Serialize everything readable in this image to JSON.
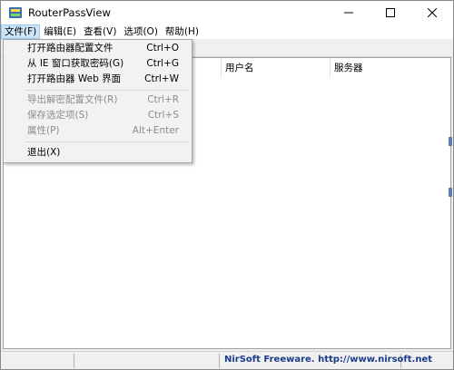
{
  "window": {
    "title": "RouterPassView"
  },
  "menubar": {
    "items": [
      "文件(F)",
      "编辑(E)",
      "查看(V)",
      "选项(O)",
      "帮助(H)"
    ]
  },
  "file_menu": {
    "items": [
      {
        "label": "打开路由器配置文件",
        "shortcut": "Ctrl+O"
      },
      {
        "label": "从 IE 窗口获取密码(G)",
        "shortcut": "Ctrl+G"
      },
      {
        "label": "打开路由器 Web 界面",
        "shortcut": "Ctrl+W"
      },
      {
        "label": "导出解密配置文件(R)",
        "shortcut": "Ctrl+R"
      },
      {
        "label": "保存选定项(S)",
        "shortcut": "Ctrl+S"
      },
      {
        "label": "属性(P)",
        "shortcut": "Alt+Enter"
      },
      {
        "label": "退出(X)",
        "shortcut": ""
      }
    ]
  },
  "listview": {
    "columns": [
      "",
      "用户名",
      "服务器"
    ]
  },
  "statusbar": {
    "text": "NirSoft Freeware.  http://www.nirsoft.net"
  },
  "colors": {
    "menu_highlight": "#cce4f7",
    "status_text": "#1a3c8c",
    "disabled_text": "#8c8c8c"
  }
}
